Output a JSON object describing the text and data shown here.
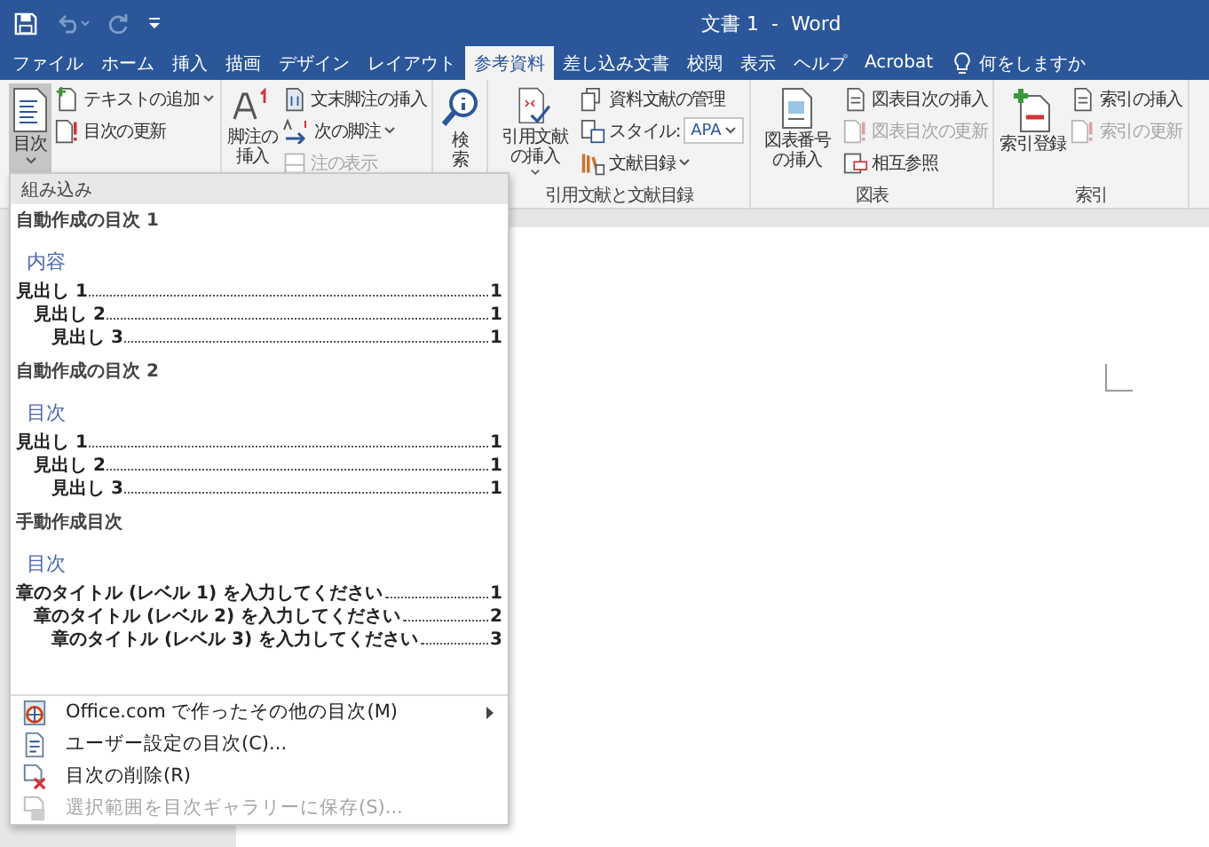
{
  "window": {
    "title": "文書 1  -  Word"
  },
  "quick_access": [
    {
      "disabled": false
    },
    {
      "disabled": true
    },
    {
      "disabled": true
    },
    {
      "disabled": false
    }
  ],
  "tabs": [
    {
      "label": "ファイル",
      "selected": false
    },
    {
      "label": "ホーム",
      "selected": false
    },
    {
      "label": "挿入",
      "selected": false
    },
    {
      "label": "描画",
      "selected": false
    },
    {
      "label": "デザイン",
      "selected": false
    },
    {
      "label": "レイアウト",
      "selected": false
    },
    {
      "label": "参考資料",
      "selected": true
    },
    {
      "label": "差し込み文書",
      "selected": false
    },
    {
      "label": "校閲",
      "selected": false
    },
    {
      "label": "表示",
      "selected": false
    },
    {
      "label": "ヘルプ",
      "selected": false
    },
    {
      "label": "Acrobat",
      "selected": false
    }
  ],
  "tell_me": {
    "label": "何をしますか"
  },
  "ribbon": {
    "groups": [
      {
        "items": [
          {
            "kind": "large",
            "label": "目次",
            "dropdown": true,
            "pressed": true
          },
          {
            "kind": "small",
            "label": "テキストの追加",
            "dropdown": true,
            "disabled": false
          },
          {
            "kind": "small",
            "label": "目次の更新",
            "dropdown": false,
            "disabled": false
          }
        ]
      },
      {
        "items": [
          {
            "kind": "large",
            "label": "脚注の挿入",
            "dropdown": false,
            "pressed": false
          },
          {
            "kind": "small",
            "label": "文末脚注の挿入",
            "dropdown": false,
            "disabled": false
          },
          {
            "kind": "small",
            "label": "次の脚注",
            "dropdown": true,
            "disabled": false
          },
          {
            "kind": "small",
            "label": "注の表示",
            "dropdown": false,
            "disabled": true
          }
        ]
      },
      {
        "items": [
          {
            "kind": "large",
            "label": "検索",
            "dropdown": false,
            "pressed": false
          }
        ]
      },
      {
        "label": "引用文献と文献目録",
        "items": [
          {
            "kind": "large",
            "label": "引用文献の挿入",
            "dropdown": true,
            "pressed": false
          },
          {
            "kind": "small",
            "label": "資料文献の管理",
            "dropdown": false,
            "disabled": false
          },
          {
            "kind": "combo",
            "label": "スタイル:",
            "value": "APA"
          },
          {
            "kind": "small",
            "label": "文献目録",
            "dropdown": true,
            "disabled": false
          }
        ]
      },
      {
        "label": "図表",
        "items": [
          {
            "kind": "large",
            "label": "図表番号の挿入",
            "dropdown": false,
            "pressed": false
          },
          {
            "kind": "small",
            "label": "図表目次の挿入",
            "dropdown": false,
            "disabled": false
          },
          {
            "kind": "small",
            "label": "図表目次の更新",
            "dropdown": false,
            "disabled": true
          },
          {
            "kind": "small",
            "label": "相互参照",
            "dropdown": false,
            "disabled": false
          }
        ]
      },
      {
        "label": "索引",
        "items": [
          {
            "kind": "large",
            "label": "索引登録",
            "dropdown": false,
            "pressed": false
          },
          {
            "kind": "small",
            "label": "索引の挿入",
            "dropdown": false,
            "disabled": false
          },
          {
            "kind": "small",
            "label": "索引の更新",
            "dropdown": false,
            "disabled": true
          }
        ]
      }
    ]
  },
  "menu": {
    "header": "組み込み",
    "sections": [
      {
        "title": "自動作成の目次 1",
        "heading": "内容",
        "entries": [
          {
            "text": "見出し 1",
            "page": "1",
            "children": [
              {
                "text": "見出し 2",
                "page": "1",
                "children": [
                  {
                    "text": "見出し 3",
                    "page": "1"
                  }
                ]
              }
            ]
          }
        ]
      },
      {
        "title": "自動作成の目次 2",
        "heading": "目次",
        "entries": [
          {
            "text": "見出し 1",
            "page": "1",
            "children": [
              {
                "text": "見出し 2",
                "page": "1",
                "children": [
                  {
                    "text": "見出し 3",
                    "page": "1"
                  }
                ]
              }
            ]
          }
        ]
      },
      {
        "title": "手動作成目次",
        "heading": "目次",
        "entries": [
          {
            "text": "章のタイトル (レベル 1) を入力してください",
            "page": "1",
            "children": [
              {
                "text": "章のタイトル (レベル 2) を入力してください",
                "page": "2",
                "children": [
                  {
                    "text": "章のタイトル (レベル 3) を入力してください",
                    "page": "3"
                  }
                ]
              }
            ]
          }
        ]
      }
    ],
    "items": [
      {
        "label": "Office.com で作ったその他の目次(M)",
        "submenu": true,
        "disabled": false
      },
      {
        "label": "ユーザー設定の目次(C)...",
        "submenu": false,
        "disabled": false
      },
      {
        "label": "目次の削除(R)",
        "submenu": false,
        "disabled": false
      },
      {
        "label": "選択範囲を目次ギャラリーに保存(S)...",
        "submenu": false,
        "disabled": true
      }
    ]
  }
}
